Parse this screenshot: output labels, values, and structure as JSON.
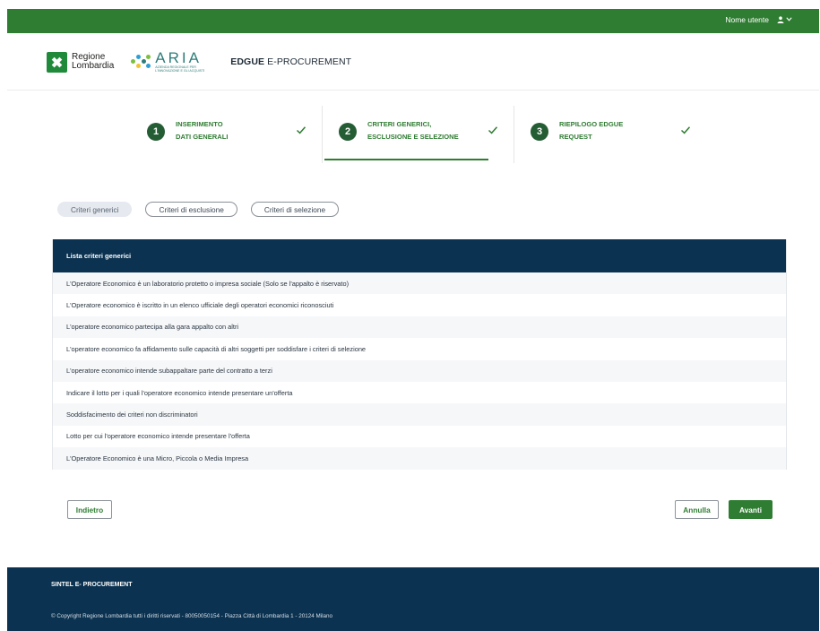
{
  "topbar": {
    "user_label": "Nome utente",
    "user_icon": "user-icon",
    "dropdown_icon": "chevron-down-icon"
  },
  "header": {
    "regione_logo_line1": "Regione",
    "regione_logo_line2": "Lombardia",
    "aria_logo_name": "ARIA",
    "aria_logo_sub1": "AZIENDA REGIONALE PER",
    "aria_logo_sub2": "L'INNOVAZIONE E GLI ACQUISTI",
    "app_title_bold": "EDGUE",
    "app_title_rest": " E-PROCUREMENT"
  },
  "stepper": {
    "steps": [
      {
        "number": "1",
        "line1": "INSERIMENTO",
        "line2": "DATI GENERALI",
        "completed": true,
        "active": false
      },
      {
        "number": "2",
        "line1": "CRITERI GENERICI,",
        "line2": "ESCLUSIONE E SELEZIONE",
        "completed": true,
        "active": true
      },
      {
        "number": "3",
        "line1": "RIEPILOGO EDGUE",
        "line2": "REQUEST",
        "completed": true,
        "active": false
      }
    ]
  },
  "tabs": {
    "items": [
      {
        "label": "Criteri generici",
        "selected": true
      },
      {
        "label": "Criteri di esclusione",
        "selected": false
      },
      {
        "label": "Criteri di selezione",
        "selected": false
      }
    ]
  },
  "table": {
    "header": "Lista criteri generici",
    "rows": [
      "L'Operatore Economico è un laboratorio protetto o impresa sociale (Solo se l'appalto è riservato)",
      "L'Operatore economico è iscritto in un elenco ufficiale degli operatori economici riconosciuti",
      "L'operatore economico partecipa alla gara appalto con altri",
      "L'operatore economico fa affidamento sulle capacità di altri soggetti per soddisfare i criteri di selezione",
      "L'operatore economico intende subappaltare parte del contratto a terzi",
      "Indicare il lotto per i quali l'operatore economico intende presentare un'offerta",
      "Soddisfacimento dei criteri non discriminatori",
      "Lotto per cui l'operatore economico intende presentare l'offerta",
      "L'Operatore Economico è una Micro, Piccola o Media Impresa"
    ]
  },
  "actions": {
    "back_label": "Indietro",
    "cancel_label": "Annulla",
    "next_label": "Avanti"
  },
  "footer": {
    "title": "SINTEL E- PROCUREMENT",
    "copyright": "© Copyright Regione Lombardia tutti i diritti riservati - 80050050154 - Piazza Città di Lombardia 1 - 20124 Milano"
  },
  "colors": {
    "brand_green": "#2f7d32",
    "dark_green": "#245c34",
    "navy": "#0b3250"
  }
}
